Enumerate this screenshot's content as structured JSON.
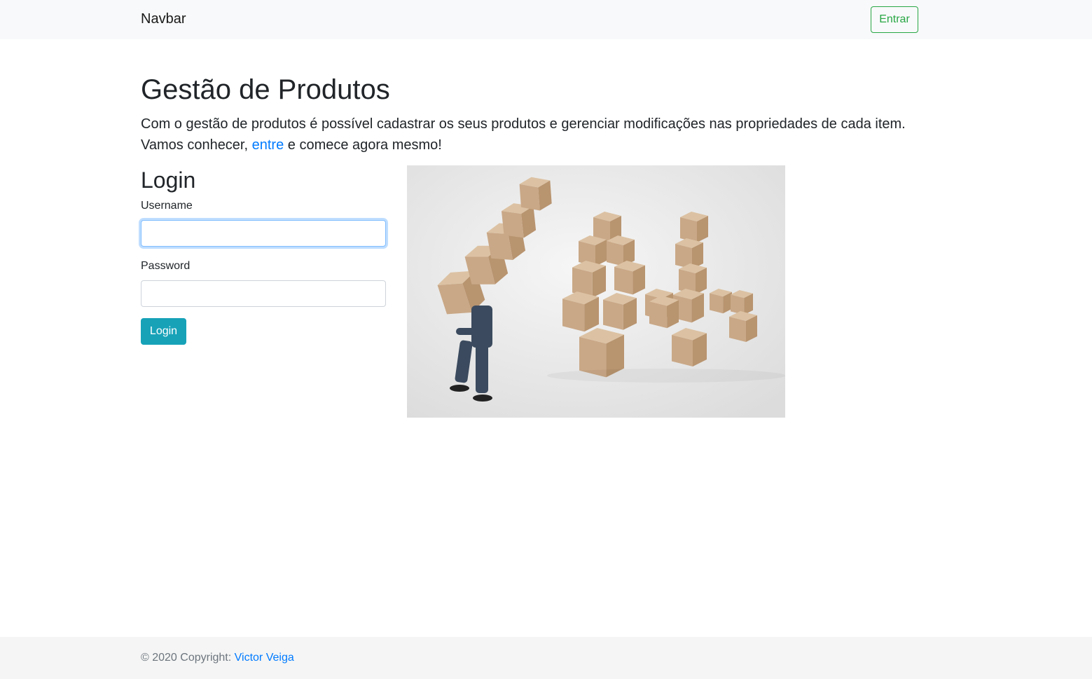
{
  "navbar": {
    "brand": "Navbar",
    "entrar_label": "Entrar"
  },
  "main": {
    "title": "Gestão de Produtos",
    "lead_text_1": "Com o gestão de produtos é possível cadastrar os seus produtos e gerenciar modificações nas propriedades de cada item. Vamos conhecer, ",
    "lead_link": "entre",
    "lead_text_2": " e comece agora mesmo!"
  },
  "login": {
    "title": "Login",
    "username_label": "Username",
    "username_value": "",
    "password_label": "Password",
    "password_value": "",
    "submit_label": "Login"
  },
  "footer": {
    "copyright_prefix": "© 2020 Copyright: ",
    "author_link": "Victor Veiga"
  },
  "colors": {
    "navbar_bg": "#f8f9fa",
    "success": "#28a745",
    "info": "#17a2b8",
    "link": "#007bff",
    "footer_bg": "#f5f5f5"
  }
}
